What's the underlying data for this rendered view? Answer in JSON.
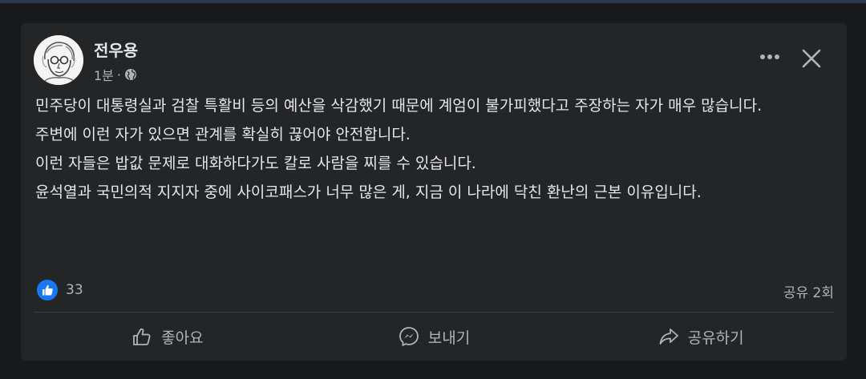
{
  "post": {
    "author": "전우용",
    "time": "1분",
    "separator": "·",
    "paragraphs": [
      "민주당이 대통령실과 검찰 특활비 등의 예산을 삭감했기 때문에 계엄이 불가피했다고 주장하는 자가 매우 많습니다.",
      "주변에 이런 자가 있으면 관계를 확실히 끊어야 안전합니다.",
      "이런 자들은 밥값 문제로 대화하다가도 칼로 사람을 찌를 수 있습니다.",
      "윤석열과 국민의적 지지자 중에 사이코패스가 너무 많은 게, 지금 이 나라에 닥친 환난의 근본 이유입니다."
    ]
  },
  "stats": {
    "reaction_count": "33",
    "shares": "공유 2회"
  },
  "actions": {
    "like": "좋아요",
    "send": "보내기",
    "share": "공유하기"
  },
  "icons": {
    "globe": "globe-icon",
    "more": "more-icon",
    "close": "close-icon",
    "like_badge": "like-badge-icon",
    "thumbs_up": "thumbs-up-icon",
    "messenger": "messenger-icon",
    "share": "share-arrow-icon"
  },
  "colors": {
    "background": "#18191a",
    "card": "#242526",
    "text_primary": "#e4e6eb",
    "text_secondary": "#b0b3b8",
    "like_blue": "#1877f2"
  }
}
